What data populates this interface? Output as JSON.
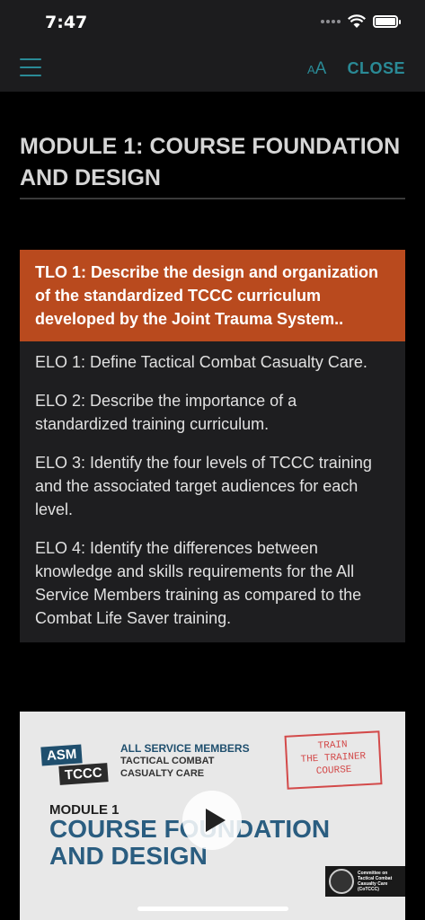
{
  "status": {
    "time": "7:47"
  },
  "nav": {
    "font_small": "A",
    "font_big": "A",
    "close_label": "CLOSE",
    "menu_icon": "hamburger-icon"
  },
  "module": {
    "title": "MODULE 1: COURSE FOUNDATION AND DESIGN"
  },
  "tlo": {
    "text": "TLO 1: Describe the design and organization of the standardized TCCC curriculum developed by the Joint Trauma System.."
  },
  "elos": [
    "ELO 1: Define Tactical Combat Casualty Care.",
    "ELO 2: Describe the importance of a standardized training curriculum.",
    "ELO 3: Identify the four levels of TCCC training and the associated target audiences for each level.",
    "ELO 4: Identify the differences between knowledge and skills requirements for the All Service Members training as compared to the Combat Life Saver training."
  ],
  "video": {
    "badge_asm": "ASM",
    "badge_tccc": "TCCC",
    "asm_line1": "ALL SERVICE MEMBERS",
    "asm_line2": "TACTICAL COMBAT",
    "asm_line3": "CASUALTY CARE",
    "stamp_line1": "TRAIN",
    "stamp_line2": "THE TRAINER",
    "stamp_line3": "COURSE",
    "module_label": "MODULE 1",
    "title_line1": "COURSE FOUNDATION",
    "title_line2": "AND DESIGN",
    "logo_line1": "Committee on",
    "logo_line2": "Tactical Combat",
    "logo_line3": "Casualty Care",
    "logo_line4": "(CoTCCC)"
  },
  "colors": {
    "accent": "#2a8a96",
    "tlo_bg": "#b94a1e",
    "elo_bg": "#1e1e20"
  }
}
